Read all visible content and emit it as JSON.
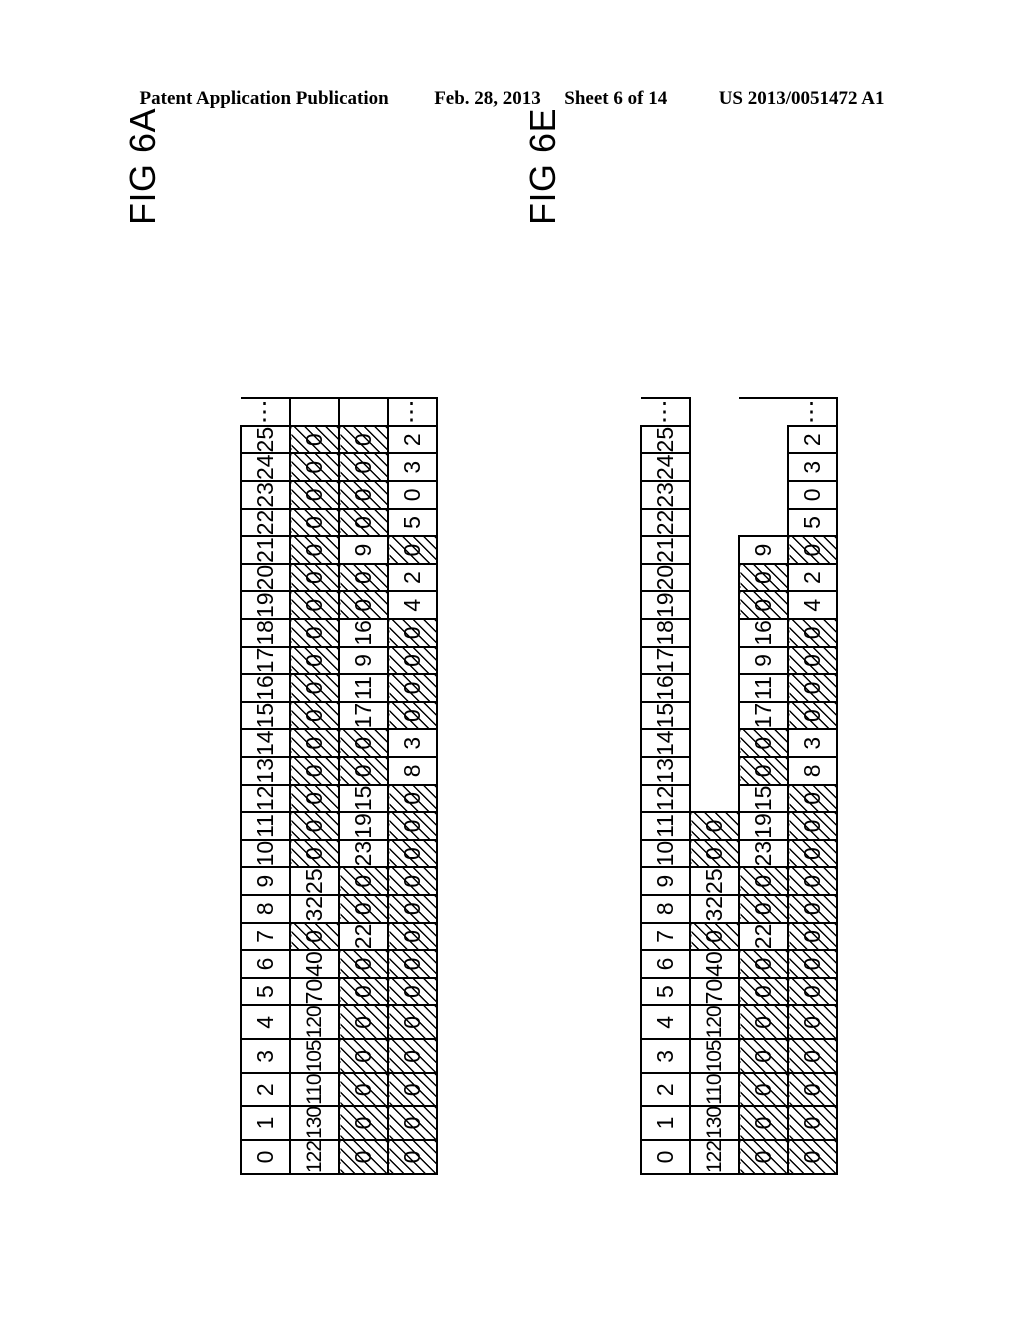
{
  "header": {
    "publication": "Patent Application Publication",
    "date": "Feb. 28, 2013",
    "sheet": "Sheet 6 of 14",
    "patent_number": "US 2013/0051472 A1"
  },
  "figures": [
    {
      "id": "fig-6a",
      "label": "FIG 6A",
      "columns": [
        "0",
        "1",
        "2",
        "3",
        "4",
        "5",
        "6",
        "7",
        "8",
        "9",
        "10",
        "11",
        "12",
        "13",
        "14",
        "15",
        "16",
        "17",
        "18",
        "19",
        "20",
        "21",
        "22",
        "23",
        "24",
        "25",
        "⋮"
      ],
      "rows": [
        {
          "name": "index-row",
          "cells": [
            {
              "v": "0"
            },
            {
              "v": "1"
            },
            {
              "v": "2"
            },
            {
              "v": "3"
            },
            {
              "v": "4"
            },
            {
              "v": "5"
            },
            {
              "v": "6"
            },
            {
              "v": "7"
            },
            {
              "v": "8"
            },
            {
              "v": "9"
            },
            {
              "v": "10"
            },
            {
              "v": "11"
            },
            {
              "v": "12"
            },
            {
              "v": "13"
            },
            {
              "v": "14"
            },
            {
              "v": "15"
            },
            {
              "v": "16"
            },
            {
              "v": "17"
            },
            {
              "v": "18"
            },
            {
              "v": "19"
            },
            {
              "v": "20"
            },
            {
              "v": "21"
            },
            {
              "v": "22"
            },
            {
              "v": "23"
            },
            {
              "v": "24"
            },
            {
              "v": "25"
            },
            {
              "v": "⋮",
              "style": "ellipsis"
            }
          ]
        },
        {
          "name": "value-row-1",
          "cells": [
            {
              "v": "122"
            },
            {
              "v": "130"
            },
            {
              "v": "110"
            },
            {
              "v": "105"
            },
            {
              "v": "120"
            },
            {
              "v": "70"
            },
            {
              "v": "40"
            },
            {
              "v": "0",
              "style": "hatch"
            },
            {
              "v": "32"
            },
            {
              "v": "25"
            },
            {
              "v": "0",
              "style": "hatch"
            },
            {
              "v": "0",
              "style": "hatch"
            },
            {
              "v": "0",
              "style": "hatch"
            },
            {
              "v": "0",
              "style": "hatch"
            },
            {
              "v": "0",
              "style": "hatch"
            },
            {
              "v": "0",
              "style": "hatch"
            },
            {
              "v": "0",
              "style": "hatch"
            },
            {
              "v": "0",
              "style": "hatch"
            },
            {
              "v": "0",
              "style": "hatch"
            },
            {
              "v": "0",
              "style": "hatch"
            },
            {
              "v": "0",
              "style": "hatch"
            },
            {
              "v": "0",
              "style": "hatch"
            },
            {
              "v": "0",
              "style": "hatch"
            },
            {
              "v": "0",
              "style": "hatch"
            },
            {
              "v": "0",
              "style": "hatch"
            },
            {
              "v": "0",
              "style": "hatch"
            },
            {
              "v": "",
              "style": "ellipsis-empty"
            }
          ]
        },
        {
          "name": "value-row-2",
          "cells": [
            {
              "v": "0",
              "style": "hatch"
            },
            {
              "v": "0",
              "style": "hatch"
            },
            {
              "v": "0",
              "style": "hatch"
            },
            {
              "v": "0",
              "style": "hatch"
            },
            {
              "v": "0",
              "style": "hatch"
            },
            {
              "v": "0",
              "style": "hatch"
            },
            {
              "v": "0",
              "style": "hatch"
            },
            {
              "v": "22"
            },
            {
              "v": "0",
              "style": "hatch"
            },
            {
              "v": "0",
              "style": "hatch"
            },
            {
              "v": "23"
            },
            {
              "v": "19"
            },
            {
              "v": "15"
            },
            {
              "v": "0",
              "style": "hatch"
            },
            {
              "v": "0",
              "style": "hatch"
            },
            {
              "v": "17"
            },
            {
              "v": "11"
            },
            {
              "v": "9"
            },
            {
              "v": "16"
            },
            {
              "v": "0",
              "style": "hatch"
            },
            {
              "v": "0",
              "style": "hatch"
            },
            {
              "v": "9"
            },
            {
              "v": "0",
              "style": "hatch"
            },
            {
              "v": "0",
              "style": "hatch"
            },
            {
              "v": "0",
              "style": "hatch"
            },
            {
              "v": "0",
              "style": "hatch"
            },
            {
              "v": "",
              "style": "ellipsis-empty"
            }
          ]
        },
        {
          "name": "value-row-3",
          "cells": [
            {
              "v": "0",
              "style": "hatch"
            },
            {
              "v": "0",
              "style": "hatch"
            },
            {
              "v": "0",
              "style": "hatch"
            },
            {
              "v": "0",
              "style": "hatch"
            },
            {
              "v": "0",
              "style": "hatch"
            },
            {
              "v": "0",
              "style": "hatch"
            },
            {
              "v": "0",
              "style": "hatch"
            },
            {
              "v": "0",
              "style": "hatch"
            },
            {
              "v": "0",
              "style": "hatch"
            },
            {
              "v": "0",
              "style": "hatch"
            },
            {
              "v": "0",
              "style": "hatch"
            },
            {
              "v": "0",
              "style": "hatch"
            },
            {
              "v": "0",
              "style": "hatch"
            },
            {
              "v": "8"
            },
            {
              "v": "3"
            },
            {
              "v": "0",
              "style": "hatch"
            },
            {
              "v": "0",
              "style": "hatch"
            },
            {
              "v": "0",
              "style": "hatch"
            },
            {
              "v": "0",
              "style": "hatch"
            },
            {
              "v": "4"
            },
            {
              "v": "2"
            },
            {
              "v": "0",
              "style": "hatch"
            },
            {
              "v": "5"
            },
            {
              "v": "0"
            },
            {
              "v": "3"
            },
            {
              "v": "2"
            },
            {
              "v": "⋮",
              "style": "ellipsis"
            }
          ]
        }
      ]
    },
    {
      "id": "fig-6e",
      "label": "FIG 6E",
      "columns": [
        "0",
        "1",
        "2",
        "3",
        "4",
        "5",
        "6",
        "7",
        "8",
        "9",
        "10",
        "11",
        "12",
        "13",
        "14",
        "15",
        "16",
        "17",
        "18",
        "19",
        "20",
        "21",
        "22",
        "23",
        "24",
        "25",
        "⋮"
      ],
      "rows": [
        {
          "name": "index-row",
          "cells": [
            {
              "v": "0"
            },
            {
              "v": "1"
            },
            {
              "v": "2"
            },
            {
              "v": "3"
            },
            {
              "v": "4"
            },
            {
              "v": "5"
            },
            {
              "v": "6"
            },
            {
              "v": "7"
            },
            {
              "v": "8"
            },
            {
              "v": "9"
            },
            {
              "v": "10"
            },
            {
              "v": "11"
            },
            {
              "v": "12"
            },
            {
              "v": "13"
            },
            {
              "v": "14"
            },
            {
              "v": "15"
            },
            {
              "v": "16"
            },
            {
              "v": "17"
            },
            {
              "v": "18"
            },
            {
              "v": "19"
            },
            {
              "v": "20"
            },
            {
              "v": "21"
            },
            {
              "v": "22"
            },
            {
              "v": "23"
            },
            {
              "v": "24"
            },
            {
              "v": "25"
            },
            {
              "v": "⋮",
              "style": "ellipsis"
            }
          ]
        },
        {
          "name": "value-row-1",
          "cells": [
            {
              "v": "122"
            },
            {
              "v": "130"
            },
            {
              "v": "110"
            },
            {
              "v": "105"
            },
            {
              "v": "120"
            },
            {
              "v": "70"
            },
            {
              "v": "40"
            },
            {
              "v": "0",
              "style": "hatch"
            },
            {
              "v": "32"
            },
            {
              "v": "25"
            },
            {
              "v": "0",
              "style": "hatch"
            },
            {
              "v": "0",
              "style": "hatch"
            },
            {
              "v": "",
              "style": "blank"
            },
            {
              "v": "",
              "style": "blank"
            },
            {
              "v": "",
              "style": "blank"
            },
            {
              "v": "",
              "style": "blank"
            },
            {
              "v": "",
              "style": "blank"
            },
            {
              "v": "",
              "style": "blank"
            },
            {
              "v": "",
              "style": "blank"
            },
            {
              "v": "",
              "style": "blank"
            },
            {
              "v": "",
              "style": "blank"
            },
            {
              "v": "",
              "style": "blank"
            },
            {
              "v": "",
              "style": "blank"
            },
            {
              "v": "",
              "style": "blank"
            },
            {
              "v": "",
              "style": "blank"
            },
            {
              "v": "",
              "style": "blank"
            },
            {
              "v": "",
              "style": "ellipsis-blank"
            }
          ]
        },
        {
          "name": "value-row-2",
          "cells": [
            {
              "v": "0",
              "style": "hatch"
            },
            {
              "v": "0",
              "style": "hatch"
            },
            {
              "v": "0",
              "style": "hatch"
            },
            {
              "v": "0",
              "style": "hatch"
            },
            {
              "v": "0",
              "style": "hatch"
            },
            {
              "v": "0",
              "style": "hatch"
            },
            {
              "v": "0",
              "style": "hatch"
            },
            {
              "v": "22"
            },
            {
              "v": "0",
              "style": "hatch"
            },
            {
              "v": "0",
              "style": "hatch"
            },
            {
              "v": "23"
            },
            {
              "v": "19"
            },
            {
              "v": "15"
            },
            {
              "v": "0",
              "style": "hatch"
            },
            {
              "v": "0",
              "style": "hatch"
            },
            {
              "v": "17"
            },
            {
              "v": "11"
            },
            {
              "v": "9"
            },
            {
              "v": "16"
            },
            {
              "v": "0",
              "style": "hatch"
            },
            {
              "v": "0",
              "style": "hatch"
            },
            {
              "v": "9"
            },
            {
              "v": "",
              "style": "blank"
            },
            {
              "v": "",
              "style": "blank"
            },
            {
              "v": "",
              "style": "blank"
            },
            {
              "v": "",
              "style": "blank"
            },
            {
              "v": "",
              "style": "ellipsis-blank-side"
            }
          ]
        },
        {
          "name": "value-row-3",
          "cells": [
            {
              "v": "0",
              "style": "hatch"
            },
            {
              "v": "0",
              "style": "hatch"
            },
            {
              "v": "0",
              "style": "hatch"
            },
            {
              "v": "0",
              "style": "hatch"
            },
            {
              "v": "0",
              "style": "hatch"
            },
            {
              "v": "0",
              "style": "hatch"
            },
            {
              "v": "0",
              "style": "hatch"
            },
            {
              "v": "0",
              "style": "hatch"
            },
            {
              "v": "0",
              "style": "hatch"
            },
            {
              "v": "0",
              "style": "hatch"
            },
            {
              "v": "0",
              "style": "hatch"
            },
            {
              "v": "0",
              "style": "hatch"
            },
            {
              "v": "0",
              "style": "hatch"
            },
            {
              "v": "8"
            },
            {
              "v": "3"
            },
            {
              "v": "0",
              "style": "hatch"
            },
            {
              "v": "0",
              "style": "hatch"
            },
            {
              "v": "0",
              "style": "hatch"
            },
            {
              "v": "0",
              "style": "hatch"
            },
            {
              "v": "4"
            },
            {
              "v": "2"
            },
            {
              "v": "0",
              "style": "hatch"
            },
            {
              "v": "5"
            },
            {
              "v": "0"
            },
            {
              "v": "3"
            },
            {
              "v": "2"
            },
            {
              "v": "⋮",
              "style": "ellipsis"
            }
          ]
        }
      ]
    }
  ]
}
